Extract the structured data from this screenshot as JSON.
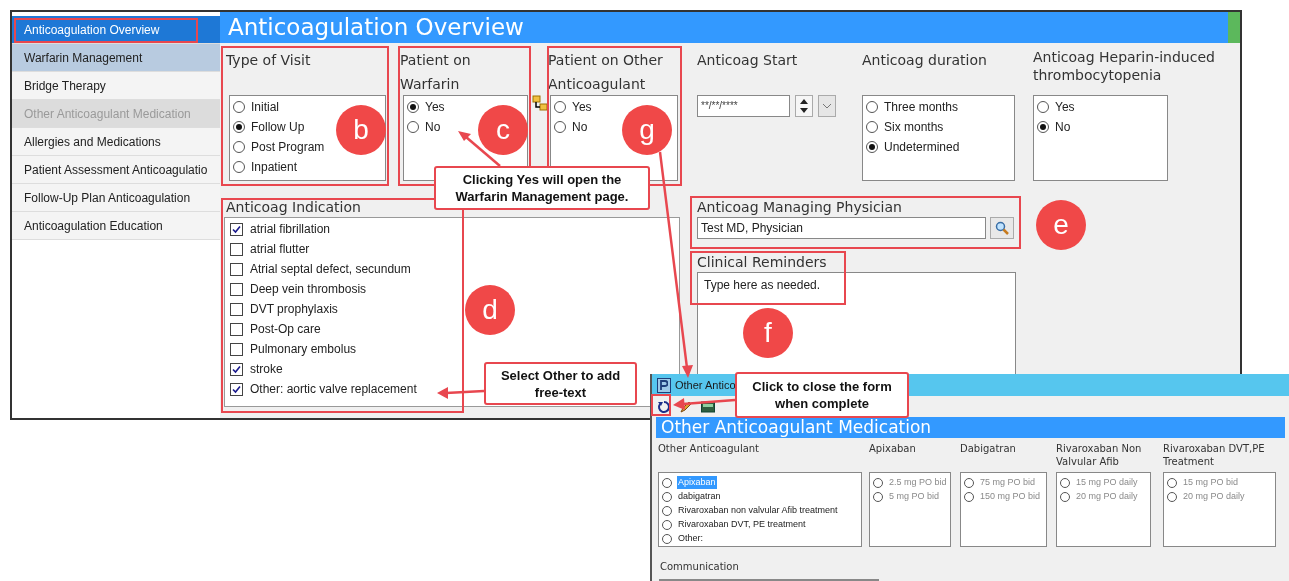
{
  "sidebar": {
    "items": [
      {
        "label": "Anticoagulation Overview",
        "selected": true,
        "highlighted": false,
        "disabled": false
      },
      {
        "label": "Warfarin Management",
        "selected": false,
        "highlighted": true,
        "disabled": false
      },
      {
        "label": "Bridge Therapy",
        "selected": false,
        "highlighted": false,
        "disabled": false
      },
      {
        "label": "Other Anticoagulant Medication",
        "selected": false,
        "highlighted": false,
        "disabled": true
      },
      {
        "label": "Allergies and Medications",
        "selected": false,
        "highlighted": false,
        "disabled": false
      },
      {
        "label": "Patient Assessment Anticoagulatio",
        "selected": false,
        "highlighted": false,
        "disabled": false
      },
      {
        "label": "Follow-Up Plan Anticoagulation",
        "selected": false,
        "highlighted": false,
        "disabled": false
      },
      {
        "label": "Anticoagulation Education",
        "selected": false,
        "highlighted": false,
        "disabled": false
      }
    ]
  },
  "page_title": "Anticoagulation Overview",
  "type_of_visit": {
    "label": "Type of Visit",
    "options": [
      {
        "label": "Initial",
        "selected": false
      },
      {
        "label": "Follow Up",
        "selected": true
      },
      {
        "label": "Post Program",
        "selected": false
      },
      {
        "label": "Inpatient",
        "selected": false
      }
    ]
  },
  "patient_on_warfarin": {
    "label": "Patient on Warfarin",
    "options": [
      {
        "label": "Yes",
        "selected": true
      },
      {
        "label": "No",
        "selected": false
      }
    ]
  },
  "patient_on_other_anticoagulant": {
    "label": "Patient on Other Anticoagulant",
    "options": [
      {
        "label": "Yes",
        "selected": false
      },
      {
        "label": "No",
        "selected": false
      }
    ]
  },
  "anticoag_start": {
    "label": "Anticoag Start",
    "value": "**/**/****"
  },
  "anticoag_duration": {
    "label": "Anticoag duration",
    "options": [
      {
        "label": "Three months",
        "selected": false
      },
      {
        "label": "Six months",
        "selected": false
      },
      {
        "label": "Undetermined",
        "selected": true
      }
    ]
  },
  "heparin_induced_thrombocytopenia": {
    "label": "Anticoag Heparin-induced thrombocytopenia",
    "options": [
      {
        "label": "Yes",
        "selected": false
      },
      {
        "label": "No",
        "selected": true
      }
    ]
  },
  "anticoag_indication": {
    "label": "Anticoag Indication",
    "items": [
      {
        "label": "atrial fibrillation",
        "checked": true
      },
      {
        "label": "atrial flutter",
        "checked": false
      },
      {
        "label": "Atrial septal defect, secundum",
        "checked": false
      },
      {
        "label": "Deep vein thrombosis",
        "checked": false
      },
      {
        "label": "DVT prophylaxis",
        "checked": false
      },
      {
        "label": "Post-Op care",
        "checked": false
      },
      {
        "label": "Pulmonary embolus",
        "checked": false
      },
      {
        "label": "stroke",
        "checked": true
      },
      {
        "label": "Other: aortic valve replacement",
        "checked": true
      }
    ]
  },
  "managing_physician": {
    "label": "Anticoag Managing Physician",
    "value": "Test MD, Physician"
  },
  "clinical_reminders": {
    "label": "Clinical Reminders",
    "value": "Type here as needed."
  },
  "popup": {
    "title": "Other Antico",
    "header": "Other Anticoagulant Medication",
    "groups": [
      {
        "label": "Other Anticoagulant",
        "disabled": false,
        "options": [
          {
            "label": "Apixaban",
            "selected": false,
            "highlighted": true
          },
          {
            "label": "dabigatran",
            "selected": false,
            "highlighted": false
          },
          {
            "label": "Rivaroxaban non valvular Afib treatment",
            "selected": false,
            "highlighted": false
          },
          {
            "label": "Rivaroxaban DVT, PE treatment",
            "selected": false,
            "highlighted": false
          },
          {
            "label": "Other:",
            "selected": false,
            "highlighted": false
          }
        ]
      },
      {
        "label": "Apixaban",
        "disabled": true,
        "options": [
          {
            "label": "2.5 mg PO bid",
            "selected": false,
            "highlighted": false
          },
          {
            "label": "5 mg PO bid",
            "selected": false,
            "highlighted": false
          }
        ]
      },
      {
        "label": "Dabigatran",
        "disabled": true,
        "options": [
          {
            "label": "75 mg PO bid",
            "selected": false,
            "highlighted": false
          },
          {
            "label": "150 mg PO bid",
            "selected": false,
            "highlighted": false
          }
        ]
      },
      {
        "label": "Rivaroxaban Non Valvular Afib",
        "disabled": true,
        "options": [
          {
            "label": "15 mg PO daily",
            "selected": false,
            "highlighted": false
          },
          {
            "label": "20 mg PO daily",
            "selected": false,
            "highlighted": false
          }
        ]
      },
      {
        "label": "Rivaroxaban DVT,PE Treatment",
        "disabled": true,
        "options": [
          {
            "label": "15 mg PO bid",
            "selected": false,
            "highlighted": false
          },
          {
            "label": "20 mg PO daily",
            "selected": false,
            "highlighted": false
          }
        ]
      }
    ],
    "communication": {
      "label": "Communication"
    }
  },
  "annotations": {
    "markers": [
      "b",
      "c",
      "g",
      "d",
      "e",
      "f"
    ],
    "callouts": [
      "Clicking Yes will open the Warfarin Management page.",
      "Select Other to add free-text",
      "Click to close the form when complete"
    ]
  }
}
